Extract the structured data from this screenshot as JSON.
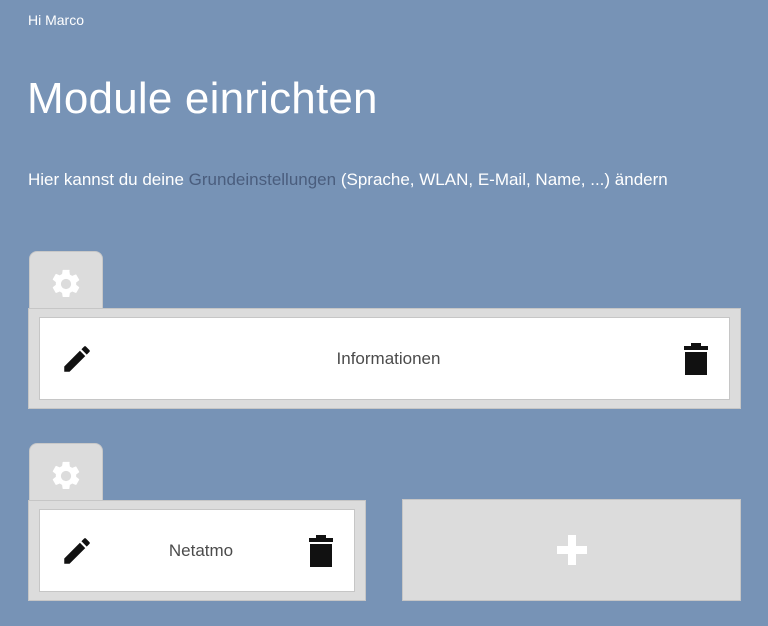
{
  "header": {
    "greeting": "Hi Marco",
    "title": "Module einrichten"
  },
  "intro": {
    "prefix": "Hier kannst du deine ",
    "link": "Grundeinstellungen",
    "suffix": " (Sprache, WLAN, E-Mail, Name, ...) ändern"
  },
  "modules": [
    {
      "title": "Informationen",
      "settings_icon": "gear-icon",
      "edit_icon": "pencil-icon",
      "delete_icon": "trash-icon"
    },
    {
      "title": "Netatmo",
      "settings_icon": "gear-icon",
      "edit_icon": "pencil-icon",
      "delete_icon": "trash-icon"
    }
  ],
  "add_tile": {
    "icon": "plus-icon"
  },
  "colors": {
    "background": "#7793b6",
    "panel": "#dcdcdc",
    "card": "#ffffff",
    "link": "#4a5d7d",
    "icon_dark": "#111111"
  }
}
